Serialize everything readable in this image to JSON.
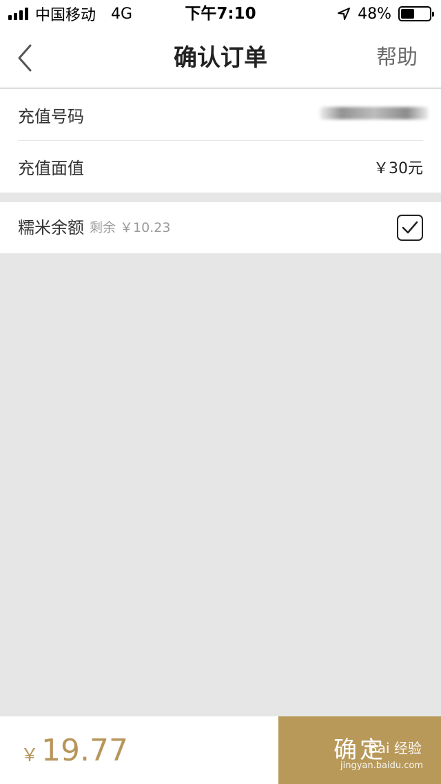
{
  "status_bar": {
    "carrier": "中国移动",
    "network": "4G",
    "time": "下午7:10",
    "battery_percent": "48%",
    "battery_level": 0.48
  },
  "nav": {
    "title": "确认订单",
    "help_label": "帮助"
  },
  "order": {
    "phone_label": "充值号码",
    "amount_label": "充值面值",
    "amount_value": "￥30元"
  },
  "balance": {
    "label": "糯米余额",
    "remaining_text": "剩余 ￥10.23",
    "checked": true
  },
  "bottom": {
    "currency": "￥",
    "total": "19.77",
    "confirm_label": "确定"
  },
  "watermark": {
    "logo_text": "Bai 经验",
    "url": "jingyan.baidu.com"
  },
  "colors": {
    "accent": "#b8995a",
    "price": "#b8955a",
    "background": "#e6e6e6"
  }
}
